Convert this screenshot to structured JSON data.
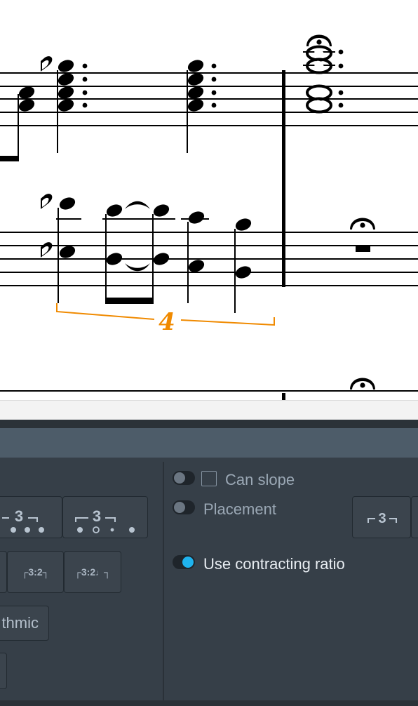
{
  "score": {
    "tuplet_number": "4",
    "accent_color": "#f08a00"
  },
  "panel": {
    "options": {
      "can_slope": "Can slope",
      "placement": "Placement",
      "use_contracting_ratio": "Use contracting ratio"
    },
    "toggles": {
      "can_slope": false,
      "placement": false,
      "use_contracting_ratio": true
    },
    "buttons": {
      "number_only": "3",
      "number_only_2": "3",
      "ratio": "3:2",
      "ratio_note": "3:2",
      "rhythmic": "thmic",
      "placement_above": "3"
    }
  },
  "colors": {
    "panel_bg": "#363f48",
    "toggle_on": "#1fb3ee"
  }
}
